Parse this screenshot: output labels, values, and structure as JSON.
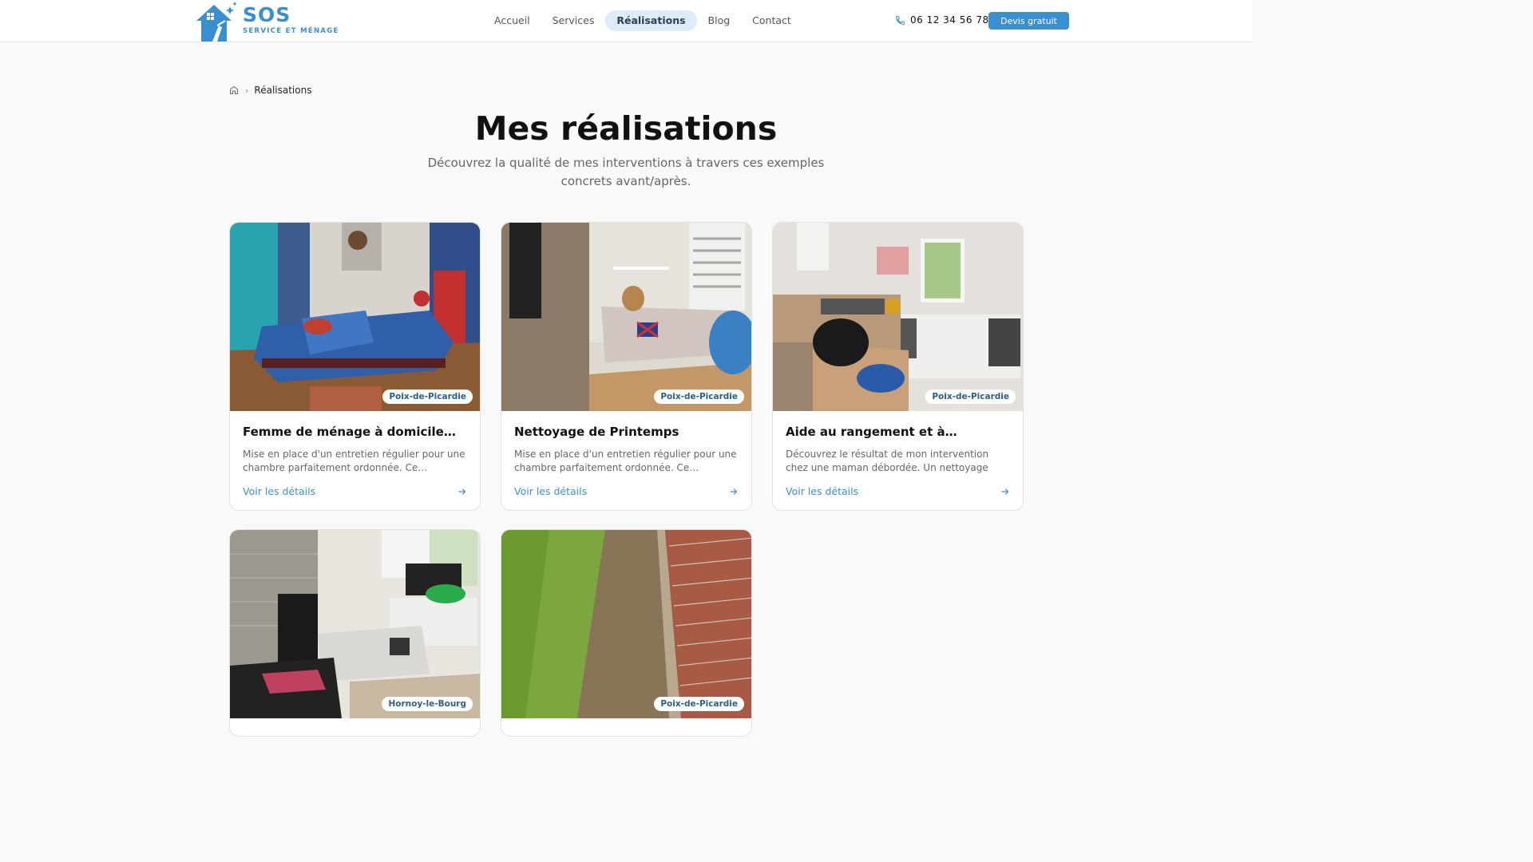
{
  "header": {
    "logo": {
      "title": "SOS",
      "subtitle": "SERVICE ET MÉNAGE"
    },
    "nav": [
      {
        "label": "Accueil",
        "active": false
      },
      {
        "label": "Services",
        "active": false
      },
      {
        "label": "Réalisations",
        "active": true
      },
      {
        "label": "Blog",
        "active": false
      },
      {
        "label": "Contact",
        "active": false
      }
    ],
    "phone": "06 12 34 56 78",
    "cta_label": "Devis gratuit"
  },
  "breadcrumb": {
    "home_icon": "home-icon",
    "current": "Réalisations"
  },
  "page": {
    "title": "Mes réalisations",
    "subtitle": "Découvrez la qualité de mes interventions à travers ces exemples concrets avant/après."
  },
  "cards": [
    {
      "location": "Poix-de-Picardie",
      "title": "Femme de ménage à domicile…",
      "description": "Mise en place d'un entretien régulier pour une chambre parfaitement ordonnée. Ce…",
      "link": "Voir les détails"
    },
    {
      "location": "Poix-de-Picardie",
      "title": "Nettoyage de Printemps",
      "description": "Mise en place d'un entretien régulier pour une chambre parfaitement ordonnée. Ce…",
      "link": "Voir les détails"
    },
    {
      "location": "Poix-de-Picardie",
      "title": "Aide au rangement et à…",
      "description": "Découvrez le résultat de mon intervention chez une maman débordée. Un nettoyage complet …",
      "link": "Voir les détails"
    },
    {
      "location": "Hornoy-le-Bourg",
      "title": "",
      "description": "",
      "link": ""
    },
    {
      "location": "Poix-de-Picardie",
      "title": "",
      "description": "",
      "link": ""
    }
  ],
  "colors": {
    "accent": "#3a8fd0",
    "nav_active_bg": "#dcecf8",
    "page_bg": "#f9f9f9"
  }
}
